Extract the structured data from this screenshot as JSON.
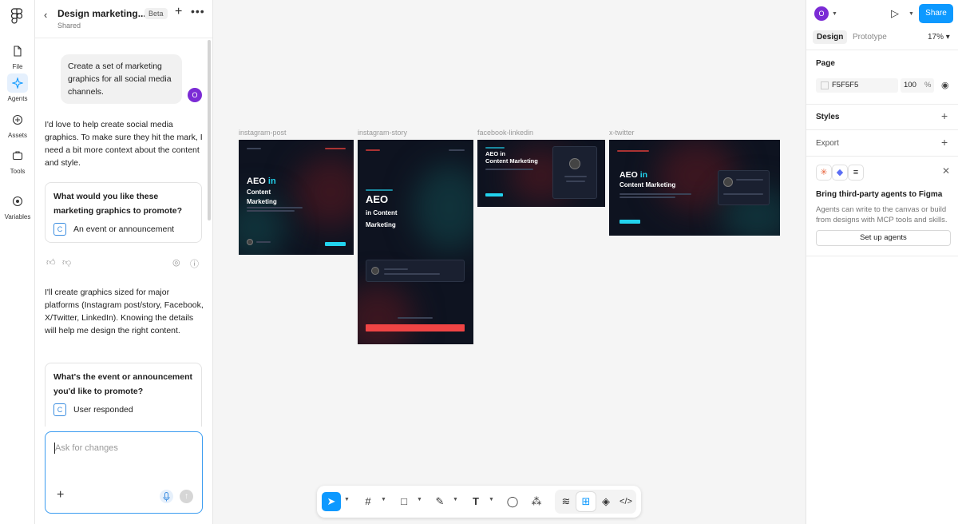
{
  "rail": {
    "items": [
      {
        "label": "File"
      },
      {
        "label": "Agents"
      },
      {
        "label": "Assets"
      },
      {
        "label": "Tools"
      },
      {
        "label": "Variables"
      }
    ]
  },
  "chat": {
    "title": "Design marketing...",
    "beta": "Beta",
    "subtitle": "Shared",
    "user_message": "Create a set of marketing graphics for all social media channels.",
    "user_avatar": "O",
    "agent_message_1": "I'd love to help create social media graphics. To make sure they hit the mark, I need a bit more context about the content and style.",
    "question_1": "What would you like these marketing graphics to promote?",
    "answer_1": "An event or announcement",
    "agent_message_2": "I'll create graphics sized for major platforms (Instagram post/story, Facebook, X/Twitter, LinkedIn). Knowing the details will help me design the right content.",
    "question_2": "What's the event or announcement you'd like to promote?",
    "answer_2": "User responded",
    "answer_badge": "C",
    "input_placeholder": "Ask for changes"
  },
  "canvas": {
    "frames": [
      {
        "label": "instagram-post",
        "title_a": "AEO",
        "title_b": "in",
        "title_c": "Content",
        "title_d": "Marketing"
      },
      {
        "label": "instagram-story",
        "title_a": "AEO",
        "title_b": "in Content",
        "title_c": "Marketing"
      },
      {
        "label": "facebook-linkedin",
        "title_a": "AEO in",
        "title_b": "Content Marketing"
      },
      {
        "label": "x-twitter",
        "title_a": "AEO",
        "title_b": "in",
        "title_c": "Content Marketing"
      }
    ],
    "accent": "#22d3ee",
    "frame_bg": "#0e1320"
  },
  "props": {
    "avatar": "O",
    "share": "Share",
    "tab_design": "Design",
    "tab_prototype": "Prototype",
    "zoom": "17%",
    "page_label": "Page",
    "page_color": "F5F5F5",
    "page_opacity": "100",
    "pct": "%",
    "styles_label": "Styles",
    "export_label": "Export",
    "banner_title": "Bring third-party agents to Figma",
    "banner_desc": "Agents can write to the canvas or build from designs with MCP tools and skills.",
    "setup_button": "Set up agents"
  },
  "help": "?"
}
